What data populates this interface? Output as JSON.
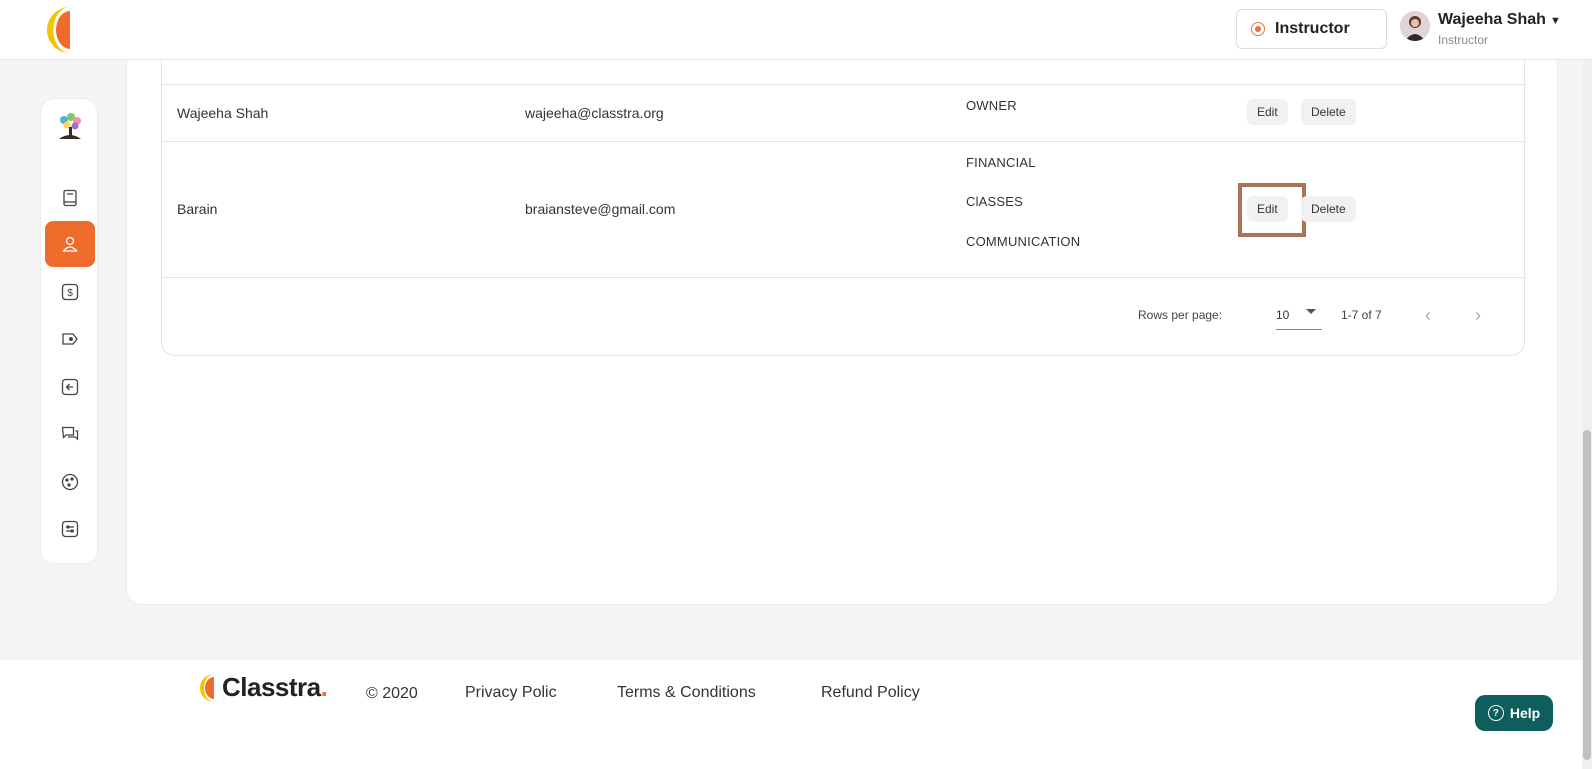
{
  "header": {
    "role_switch_label": "Instructor",
    "user_name": "Wajeeha Shah",
    "user_role": "Instructor"
  },
  "sidebar": {
    "items": [
      {
        "icon": "book-icon",
        "active": false
      },
      {
        "icon": "user-icon",
        "active": true
      },
      {
        "icon": "dollar-icon",
        "active": false
      },
      {
        "icon": "tag-icon",
        "active": false
      },
      {
        "icon": "login-icon",
        "active": false
      },
      {
        "icon": "chat-icon",
        "active": false
      },
      {
        "icon": "palette-icon",
        "active": false
      },
      {
        "icon": "settings-list-icon",
        "active": false
      }
    ]
  },
  "table": {
    "rows": [
      {
        "name": "Wajeeha Shah",
        "email": "wajeeha@classtra.org",
        "permissions": [
          "OWNER"
        ],
        "edit_label": "Edit",
        "delete_label": "Delete"
      },
      {
        "name": "Barain",
        "email": "braiansteve@gmail.com",
        "permissions": [
          "FINANCIAL",
          "ClASSES",
          "COMMUNICATION"
        ],
        "edit_label": "Edit",
        "delete_label": "Delete"
      }
    ],
    "pagination": {
      "rows_per_page_label": "Rows per page:",
      "rows_per_page_value": "10",
      "range_label": "1-7 of 7"
    }
  },
  "footer": {
    "brand": "Classtra",
    "brand_dot": ".",
    "copyright": "© 2020",
    "privacy": "Privacy Polic",
    "terms": "Terms & Conditions",
    "refund": "Refund Policy",
    "help_label": "Help"
  },
  "colors": {
    "accent": "#ef6c2d",
    "help": "#0f5e5e",
    "highlight": "#a87556"
  }
}
